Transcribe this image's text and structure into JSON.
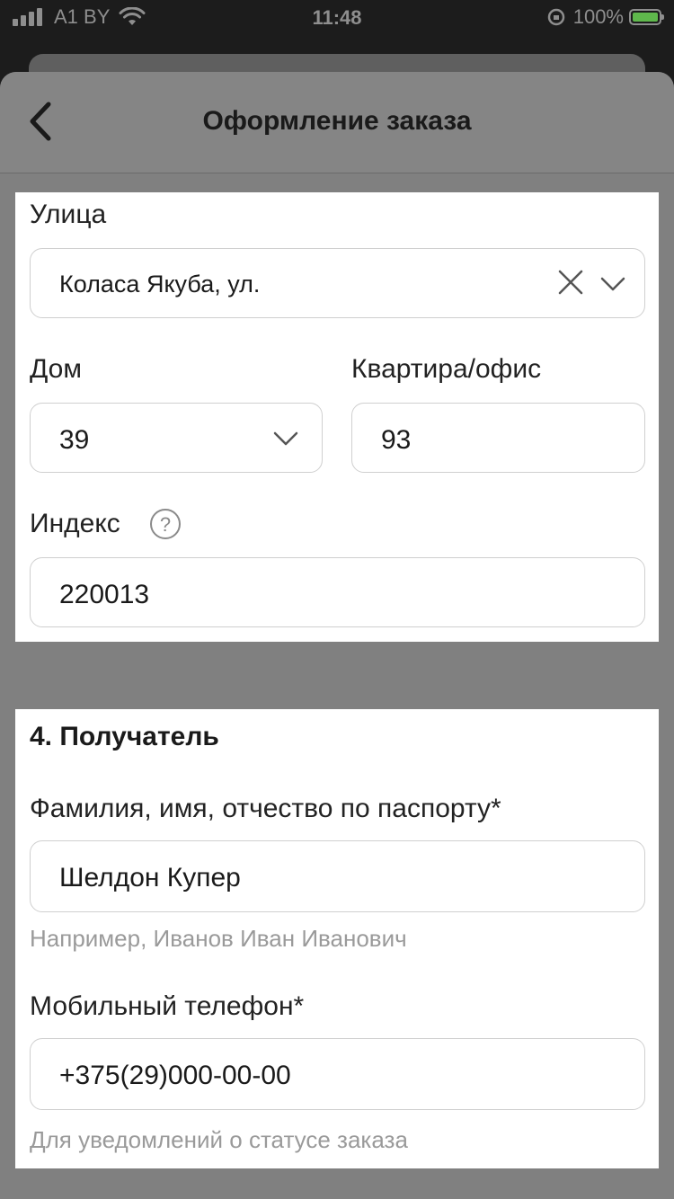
{
  "status_bar": {
    "carrier": "A1 BY",
    "time": "11:48",
    "battery": "100%"
  },
  "header": {
    "title": "Оформление заказа"
  },
  "address": {
    "street_label": "Улица",
    "street_value": "Коласа Якуба, ул.",
    "house_label": "Дом",
    "house_value": "39",
    "apartment_label": "Квартира/офис",
    "apartment_value": "93",
    "index_label": "Индекс",
    "index_value": "220013"
  },
  "recipient": {
    "section_title": "4. Получатель",
    "name_label": "Фамилия, имя, отчество по паспорту*",
    "name_value": "Шелдон Купер",
    "name_hint": "Например, Иванов Иван Иванович",
    "phone_label": "Мобильный телефон*",
    "phone_value": "+375(29)000-00-00",
    "phone_hint": "Для уведомлений о статусе заказа"
  },
  "colors": {
    "overlay": "#808080",
    "card": "#ffffff",
    "battery_fill": "#5fb84c"
  }
}
